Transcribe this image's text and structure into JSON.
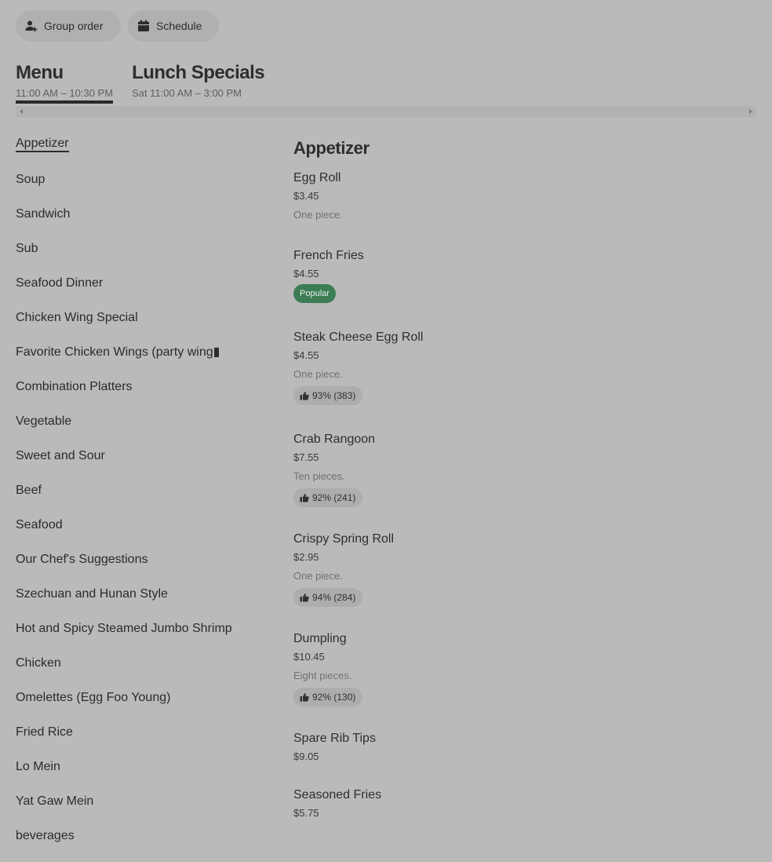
{
  "toolbar": {
    "group_order": "Group order",
    "schedule": "Schedule"
  },
  "menus": [
    {
      "title": "Menu",
      "hours": "11:00 AM – 10:30 PM"
    },
    {
      "title": "Lunch Specials",
      "hours": "Sat 11:00 AM – 3:00 PM"
    }
  ],
  "categories": [
    "Appetizer",
    "Soup",
    "Sandwich",
    "Sub",
    "Seafood Dinner",
    "Chicken Wing Special",
    "Favorite Chicken Wings (party wing▮",
    "Combination Platters",
    "Vegetable",
    "Sweet and Sour",
    "Beef",
    "Seafood",
    "Our Chef's Suggestions",
    "Szechuan and Hunan Style",
    "Hot and Spicy Steamed Jumbo Shrimp",
    "Chicken",
    "Omelettes (Egg Foo Young)",
    "Fried Rice",
    "Lo Mein",
    "Yat Gaw Mein",
    "beverages"
  ],
  "section": {
    "title": "Appetizer",
    "items": [
      {
        "name": "Egg Roll",
        "price": "$3.45",
        "desc": "One piece."
      },
      {
        "name": "French Fries",
        "price": "$4.55",
        "badge": "Popular"
      },
      {
        "name": "Steak Cheese Egg Roll",
        "price": "$4.55",
        "desc": "One piece.",
        "rating": "93% (383)"
      },
      {
        "name": "Crab Rangoon",
        "price": "$7.55",
        "desc": "Ten pieces.",
        "rating": "92% (241)"
      },
      {
        "name": "Crispy Spring Roll",
        "price": "$2.95",
        "desc": "One piece.",
        "rating": "94% (284)"
      },
      {
        "name": "Dumpling",
        "price": "$10.45",
        "desc": "Eight pieces.",
        "rating": "92% (130)"
      },
      {
        "name": "Spare Rib Tips",
        "price": "$9.05"
      },
      {
        "name": "Seasoned Fries",
        "price": "$5.75"
      }
    ]
  },
  "colors": {
    "background": "#bababa",
    "popular_badge": "#3c7d55"
  }
}
